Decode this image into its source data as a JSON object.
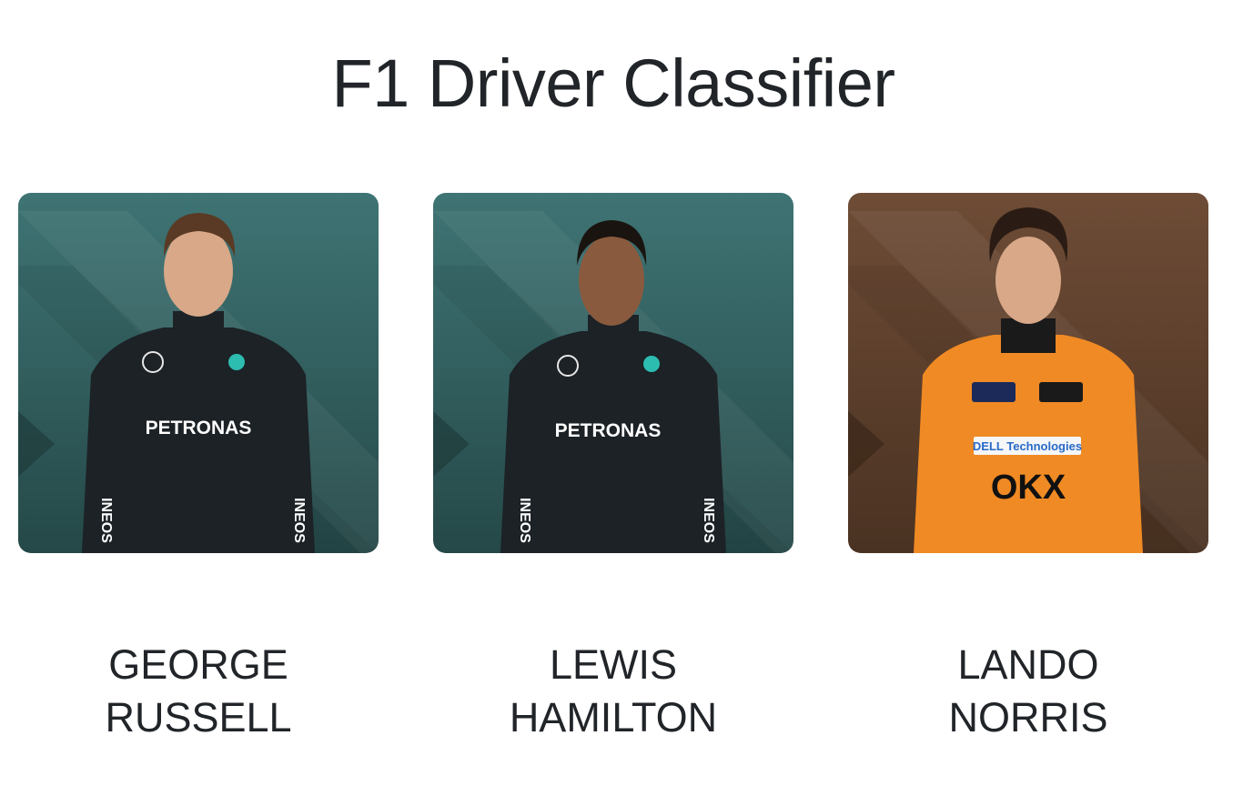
{
  "page": {
    "title": "F1 Driver Classifier"
  },
  "drivers": [
    {
      "first_name": "GEORGE",
      "last_name": "RUSSELL",
      "bg_color": "#3a6a6a",
      "suit_color": "#1c2226",
      "suit_text": "PETRONAS",
      "sleeve_text": "INEOS"
    },
    {
      "first_name": "LEWIS",
      "last_name": "HAMILTON",
      "bg_color": "#3a6a6a",
      "suit_color": "#1c2226",
      "suit_text": "PETRONAS",
      "sleeve_text": "INEOS"
    },
    {
      "first_name": "LANDO",
      "last_name": "NORRIS",
      "bg_color": "#6a4a34",
      "suit_color": "#f08a24",
      "suit_text": "OKX",
      "sleeve_text": "DELL Technologies"
    }
  ]
}
